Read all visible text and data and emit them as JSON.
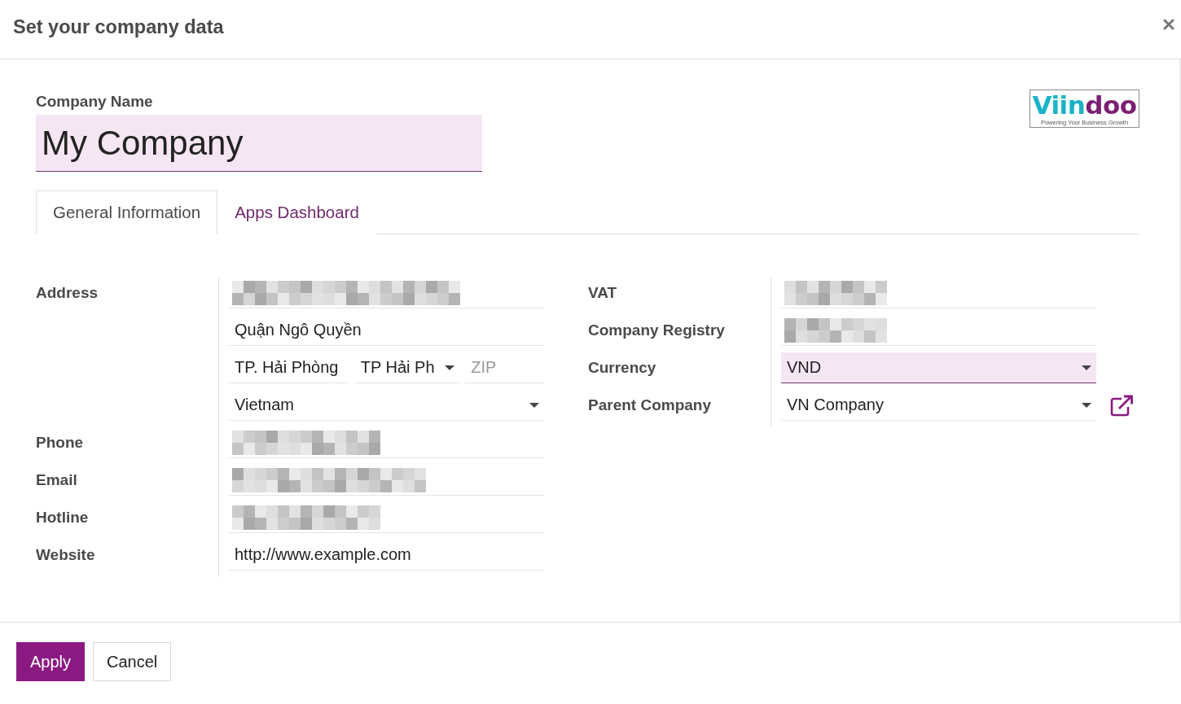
{
  "dialog": {
    "title": "Set your company data"
  },
  "company_name": {
    "label": "Company Name",
    "value": "My Company",
    "required": true
  },
  "logo": {
    "wordmark": [
      {
        "text": "Viin",
        "color": "#1ab3c8"
      },
      {
        "text": "doo",
        "color": "#7a1f73"
      }
    ],
    "tagline": "Powering Your Business Growth"
  },
  "tabs": [
    {
      "label": "General Information",
      "selected": true
    },
    {
      "label": "Apps Dashboard",
      "selected": false
    }
  ],
  "groups": [
    {
      "items": [
        {
          "label": "Address",
          "link_button": false,
          "lines": [
            [
              {
                "kind": "redacted",
                "required": false
              }
            ],
            [
              {
                "kind": "text",
                "value": "Quận Ngô Quyền",
                "required": false
              }
            ],
            [
              {
                "kind": "text",
                "value": "TP. Hải Phòng",
                "required": false
              },
              {
                "kind": "select",
                "value": "TP Hải Ph",
                "required": false
              },
              {
                "kind": "text",
                "placeholder": "ZIP",
                "required": false
              }
            ],
            [
              {
                "kind": "select",
                "value": "Vietnam",
                "required": false
              }
            ]
          ]
        },
        {
          "label": "Phone",
          "link_button": false,
          "lines": [
            [
              {
                "kind": "redacted",
                "required": false
              }
            ]
          ]
        },
        {
          "label": "Email",
          "link_button": false,
          "lines": [
            [
              {
                "kind": "redacted",
                "required": false
              }
            ]
          ]
        },
        {
          "label": "Hotline",
          "link_button": false,
          "lines": [
            [
              {
                "kind": "redacted",
                "required": false
              }
            ]
          ]
        },
        {
          "label": "Website",
          "link_button": false,
          "lines": [
            [
              {
                "kind": "text",
                "value": "http://www.example.com",
                "required": false
              }
            ]
          ]
        }
      ]
    },
    {
      "items": [
        {
          "label": "VAT",
          "link_button": false,
          "lines": [
            [
              {
                "kind": "redacted",
                "required": false
              }
            ]
          ]
        },
        {
          "label": "Company Registry",
          "link_button": false,
          "lines": [
            [
              {
                "kind": "redacted",
                "required": false
              }
            ]
          ]
        },
        {
          "label": "Currency",
          "link_button": false,
          "lines": [
            [
              {
                "kind": "select",
                "value": "VND",
                "required": true
              }
            ]
          ]
        },
        {
          "label": "Parent Company",
          "link_button": true,
          "lines": [
            [
              {
                "kind": "select",
                "value": "VN Company",
                "required": false
              }
            ]
          ]
        }
      ]
    }
  ],
  "buttons": [
    {
      "label": "Apply",
      "kind": "primary"
    },
    {
      "label": "Cancel",
      "kind": "secondary"
    }
  ]
}
